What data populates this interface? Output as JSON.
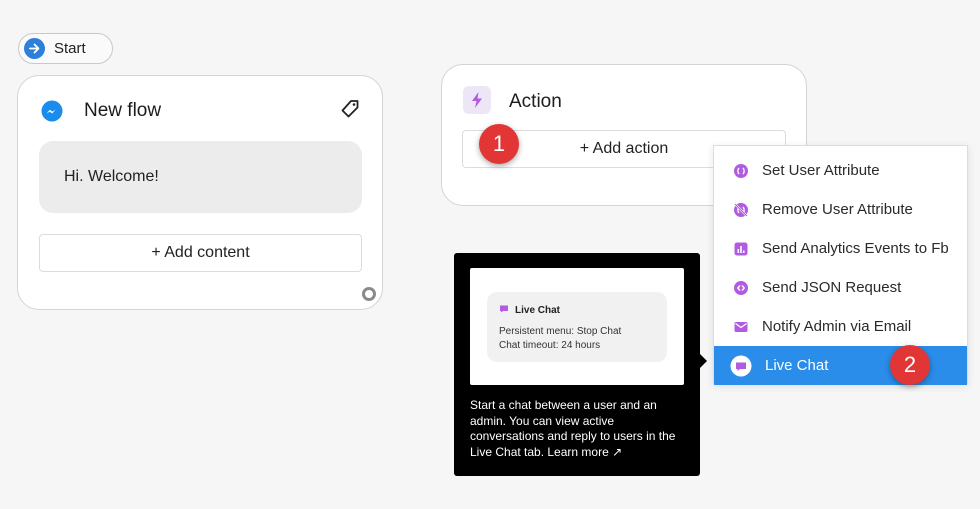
{
  "start": {
    "label": "Start"
  },
  "flow_card": {
    "title": "New flow",
    "message": "Hi. Welcome!",
    "add_content_label": "+ Add content"
  },
  "action_card": {
    "title": "Action",
    "add_action_label": "+ Add action"
  },
  "badges": {
    "first": "1",
    "second": "2"
  },
  "menu": {
    "items": [
      {
        "label": "Set User Attribute",
        "icon": "set-attribute-icon"
      },
      {
        "label": "Remove User Attribute",
        "icon": "remove-attribute-icon"
      },
      {
        "label": "Send Analytics Events to Fb",
        "icon": "analytics-icon"
      },
      {
        "label": "Send JSON Request",
        "icon": "json-request-icon"
      },
      {
        "label": "Notify Admin via Email",
        "icon": "email-icon"
      },
      {
        "label": "Live Chat",
        "icon": "live-chat-icon",
        "selected": true
      }
    ]
  },
  "tooltip": {
    "preview_title": "Live Chat",
    "preview_line1": "Persistent menu: Stop Chat",
    "preview_line2": "Chat timeout: 24 hours",
    "description": "Start a chat between a user and an admin. You can view active conversations and reply to users in the Live Chat tab. Learn more ↗"
  },
  "colors": {
    "accent_purple": "#b15ce0",
    "selected_blue": "#2a8de9",
    "badge_red": "#e23636",
    "start_blue": "#2d7fd8"
  }
}
